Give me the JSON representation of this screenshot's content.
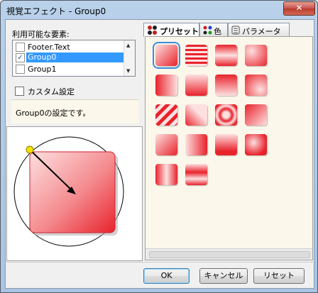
{
  "window": {
    "title": "視覚エフェクト - Group0",
    "close_glyph": "✕"
  },
  "elements": {
    "label": "利用可能な要素:",
    "items": [
      {
        "label": "Footer.Text",
        "checked": false,
        "selected": false
      },
      {
        "label": "Group0",
        "checked": true,
        "selected": true
      },
      {
        "label": "Group1",
        "checked": false,
        "selected": false
      }
    ]
  },
  "custom": {
    "label": "カスタム設定",
    "checked": false
  },
  "description": "Group0の設定です。",
  "tabs": [
    {
      "label": "プリセット",
      "icon": "preset-icon",
      "active": true
    },
    {
      "label": "色",
      "icon": "color-icon",
      "active": false
    },
    {
      "label": "パラメータ",
      "icon": "parameter-icon",
      "active": false
    }
  ],
  "presets": {
    "count": 18,
    "selected_index": 0,
    "colors": {
      "base": "#e8232c",
      "light": "#fde0e0"
    }
  },
  "buttons": {
    "ok": "OK",
    "cancel": "キャンセル",
    "reset": "リセット"
  }
}
